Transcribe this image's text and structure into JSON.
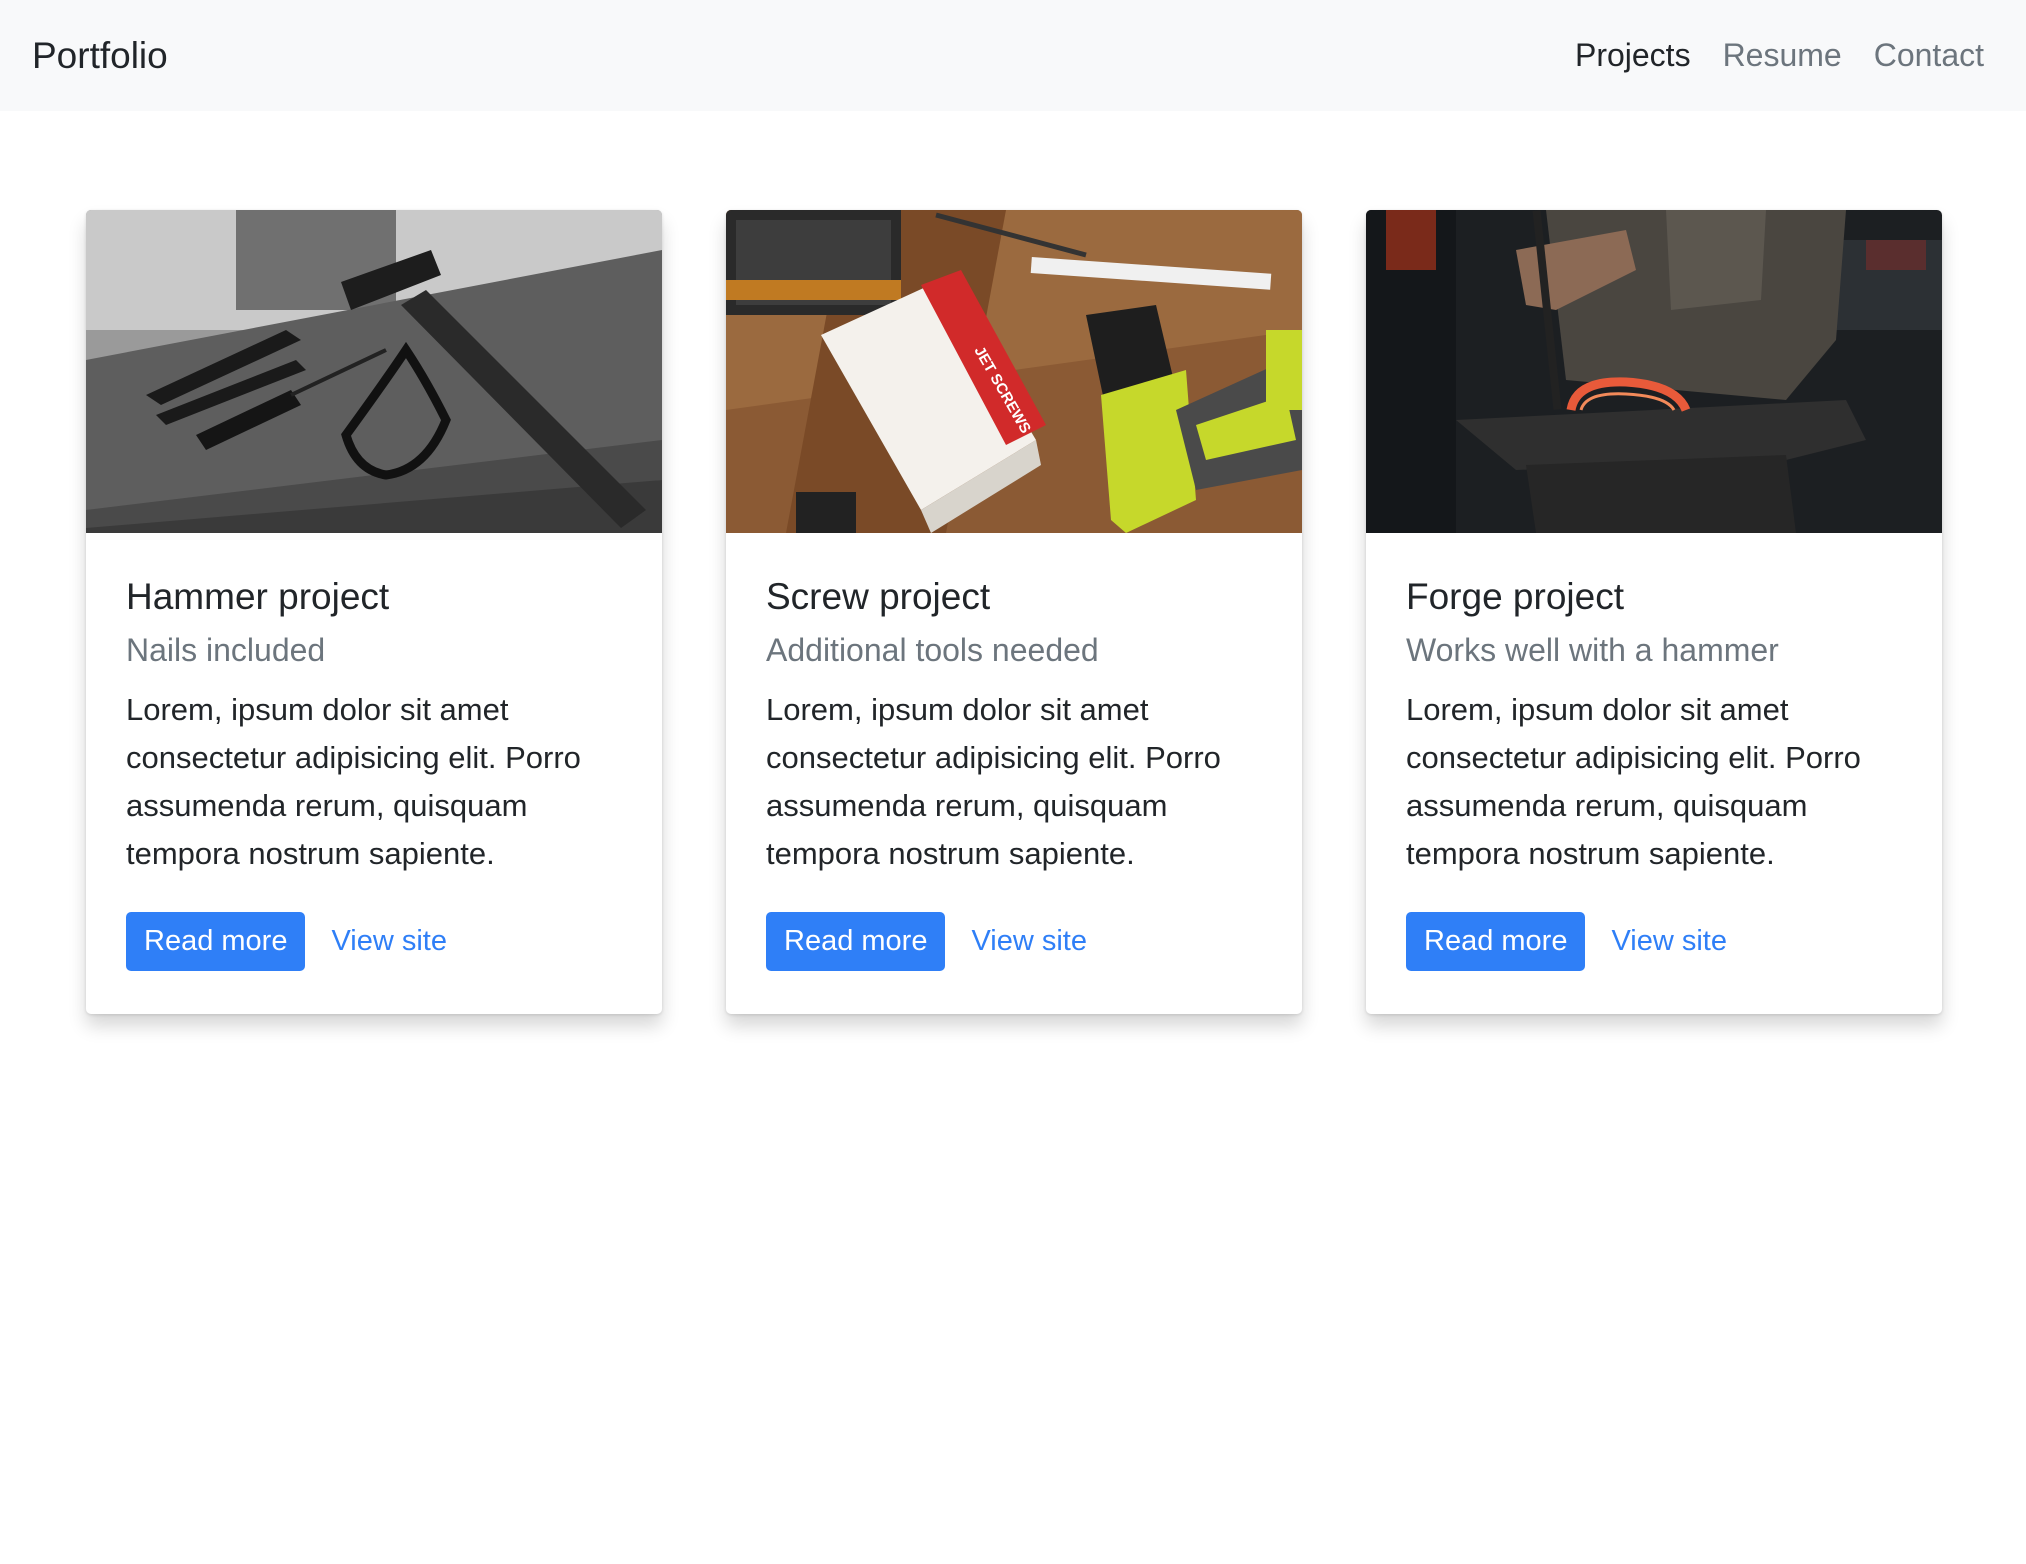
{
  "navbar": {
    "brand": "Portfolio",
    "links": [
      {
        "label": "Projects",
        "active": true
      },
      {
        "label": "Resume",
        "active": false
      },
      {
        "label": "Contact",
        "active": false
      }
    ]
  },
  "cards": [
    {
      "title": "Hammer project",
      "subtitle": "Nails included",
      "text": "Lorem, ipsum dolor sit amet consectetur adipisicing elit. Porro assumenda rerum, quisquam tempora nostrum sapiente.",
      "primary_label": "Read more",
      "secondary_label": "View site",
      "image": "hammer-pliers-screwdriver-photo"
    },
    {
      "title": "Screw project",
      "subtitle": "Additional tools needed",
      "text": "Lorem, ipsum dolor sit amet consectetur adipisicing elit. Porro assumenda rerum, quisquam tempora nostrum sapiente.",
      "primary_label": "Read more",
      "secondary_label": "View site",
      "image": "drill-and-screws-box-photo",
      "image_box_text": "JET SCREWS"
    },
    {
      "title": "Forge project",
      "subtitle": "Works well with a hammer",
      "text": "Lorem, ipsum dolor sit amet consectetur adipisicing elit. Porro assumenda rerum, quisquam tempora nostrum sapiente.",
      "primary_label": "Read more",
      "secondary_label": "View site",
      "image": "blacksmith-anvil-horseshoe-photo"
    }
  ],
  "colors": {
    "primary": "#2f7ff7",
    "navbar_bg": "#f8f9fa",
    "muted": "#6c757d",
    "text": "#212529"
  }
}
